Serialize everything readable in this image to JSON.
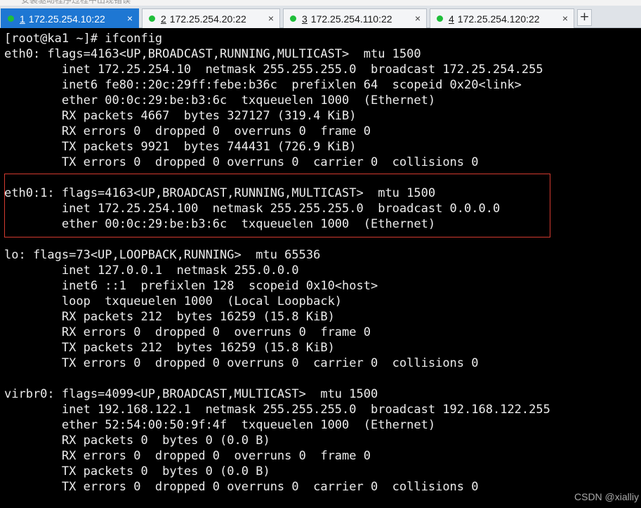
{
  "top_banner": {
    "text": "安装驱动程序过程中出现错误"
  },
  "tabs": [
    {
      "number": "1",
      "label": "172.25.254.10:22",
      "active": true,
      "status_color": "#1fbe3a",
      "close": "×"
    },
    {
      "number": "2",
      "label": "172.25.254.20:22",
      "active": false,
      "status_color": "#1fbe3a",
      "close": "×"
    },
    {
      "number": "3",
      "label": "172.25.254.110:22",
      "active": false,
      "status_color": "#1fbe3a",
      "close": "×"
    },
    {
      "number": "4",
      "label": "172.25.254.120:22",
      "active": false,
      "status_color": "#1fbe3a",
      "close": "×"
    }
  ],
  "new_tab_label": "+",
  "terminal": {
    "lines": [
      "[root@ka1 ~]# ifconfig",
      "eth0: flags=4163<UP,BROADCAST,RUNNING,MULTICAST>  mtu 1500",
      "        inet 172.25.254.10  netmask 255.255.255.0  broadcast 172.25.254.255",
      "        inet6 fe80::20c:29ff:febe:b36c  prefixlen 64  scopeid 0x20<link>",
      "        ether 00:0c:29:be:b3:6c  txqueuelen 1000  (Ethernet)",
      "        RX packets 4667  bytes 327127 (319.4 KiB)",
      "        RX errors 0  dropped 0  overruns 0  frame 0",
      "        TX packets 9921  bytes 744431 (726.9 KiB)",
      "        TX errors 0  dropped 0 overruns 0  carrier 0  collisions 0",
      "",
      "eth0:1: flags=4163<UP,BROADCAST,RUNNING,MULTICAST>  mtu 1500",
      "        inet 172.25.254.100  netmask 255.255.255.0  broadcast 0.0.0.0",
      "        ether 00:0c:29:be:b3:6c  txqueuelen 1000  (Ethernet)",
      "",
      "lo: flags=73<UP,LOOPBACK,RUNNING>  mtu 65536",
      "        inet 127.0.0.1  netmask 255.0.0.0",
      "        inet6 ::1  prefixlen 128  scopeid 0x10<host>",
      "        loop  txqueuelen 1000  (Local Loopback)",
      "        RX packets 212  bytes 16259 (15.8 KiB)",
      "        RX errors 0  dropped 0  overruns 0  frame 0",
      "        TX packets 212  bytes 16259 (15.8 KiB)",
      "        TX errors 0  dropped 0 overruns 0  carrier 0  collisions 0",
      "",
      "virbr0: flags=4099<UP,BROADCAST,MULTICAST>  mtu 1500",
      "        inet 192.168.122.1  netmask 255.255.255.0  broadcast 192.168.122.255",
      "        ether 52:54:00:50:9f:4f  txqueuelen 1000  (Ethernet)",
      "        RX packets 0  bytes 0 (0.0 B)",
      "        RX errors 0  dropped 0  overruns 0  frame 0",
      "        TX packets 0  bytes 0 (0.0 B)",
      "        TX errors 0  dropped 0 overruns 0  carrier 0  collisions 0"
    ]
  },
  "watermark": "CSDN @xialliy",
  "colors": {
    "terminal_background": "#000000",
    "terminal_text": "#ececec",
    "active_tab": "#1e77d3",
    "highlight_border": "#d33a2f",
    "status_dot": "#1fbe3a"
  }
}
